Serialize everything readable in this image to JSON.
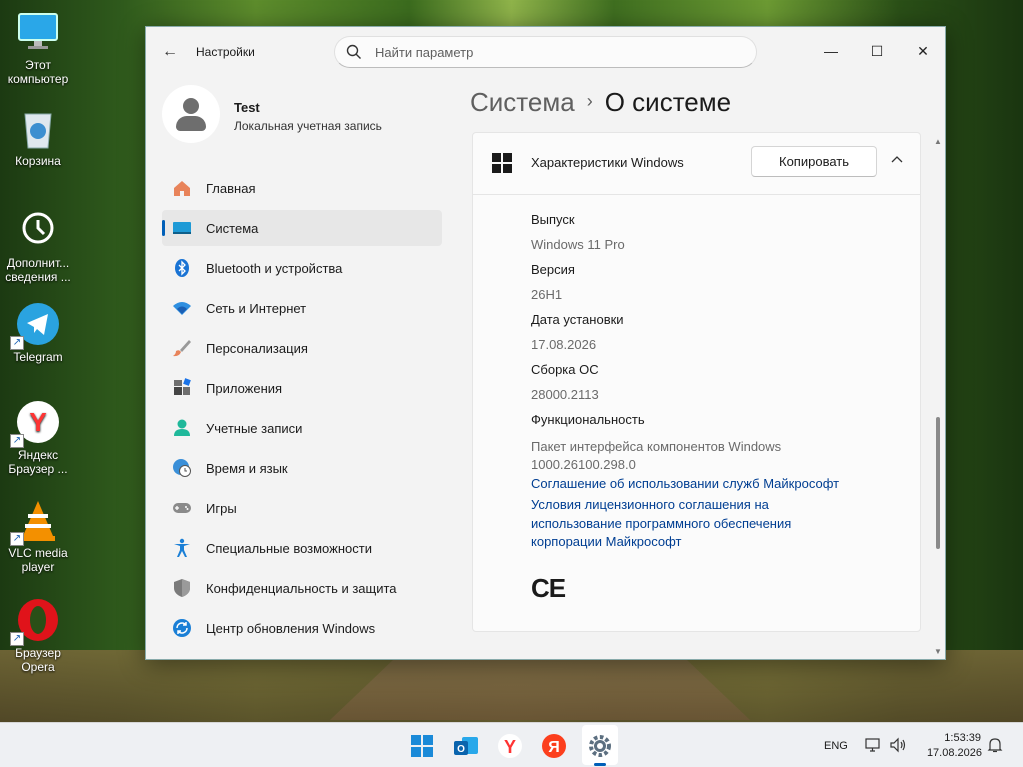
{
  "desktop": {
    "icons": [
      {
        "label": "Этот компьютер",
        "icon": "monitor-icon"
      },
      {
        "label": "Корзина",
        "icon": "recycle-bin-icon"
      },
      {
        "label": "Дополнит... сведения ...",
        "icon": "clock-icon"
      },
      {
        "label": "Telegram",
        "icon": "telegram-icon"
      },
      {
        "label": "Яндекс Браузер ...",
        "icon": "yandex-browser-icon"
      },
      {
        "label": "VLC media player",
        "icon": "vlc-icon"
      },
      {
        "label": "Браузер Opera",
        "icon": "opera-icon"
      }
    ]
  },
  "window": {
    "app_title": "Настройки",
    "search_placeholder": "Найти параметр",
    "controls": {
      "minimize": "—",
      "maximize": "☐",
      "close": "✕"
    }
  },
  "profile": {
    "name": "Test",
    "account_type": "Локальная учетная запись"
  },
  "nav": {
    "items": [
      {
        "label": "Главная",
        "icon": "home-icon"
      },
      {
        "label": "Система",
        "icon": "system-icon",
        "active": true
      },
      {
        "label": "Bluetooth и устройства",
        "icon": "bluetooth-icon"
      },
      {
        "label": "Сеть и Интернет",
        "icon": "wifi-icon"
      },
      {
        "label": "Персонализация",
        "icon": "brush-icon"
      },
      {
        "label": "Приложения",
        "icon": "apps-icon"
      },
      {
        "label": "Учетные записи",
        "icon": "accounts-icon"
      },
      {
        "label": "Время и язык",
        "icon": "globe-clock-icon"
      },
      {
        "label": "Игры",
        "icon": "gamepad-icon"
      },
      {
        "label": "Специальные возможности",
        "icon": "accessibility-icon"
      },
      {
        "label": "Конфиденциальность и защита",
        "icon": "shield-icon"
      },
      {
        "label": "Центр обновления Windows",
        "icon": "update-icon"
      }
    ]
  },
  "content": {
    "breadcrumb_parent": "Система",
    "breadcrumb_sep": "›",
    "breadcrumb_current": "О системе",
    "card_title": "Характеристики Windows",
    "copy_button": "Копировать",
    "specs": [
      {
        "label": "Выпуск",
        "value": "Windows 11 Pro"
      },
      {
        "label": "Версия",
        "value": "26H1"
      },
      {
        "label": "Дата установки",
        "value": "17.08.2026"
      },
      {
        "label": "Сборка ОС",
        "value": "28000.2113"
      },
      {
        "label": "Функциональность",
        "value": "Пакет интерфейса компонентов Windows 1000.26100.298.0"
      }
    ],
    "links": [
      "Соглашение об использовании служб Майкрософт",
      "Условия лицензионного соглашения на использование программного обеспечения корпорации Майкрософт"
    ],
    "ce_mark": "CE"
  },
  "taskbar": {
    "apps": [
      "start-icon",
      "outlook-icon",
      "yandex-browser-icon",
      "yandex-icon",
      "settings-icon"
    ],
    "lang": "ENG",
    "time": "1:53:39",
    "date": "17.08.2026"
  },
  "colors": {
    "accent": "#005fb8",
    "link": "#003e92"
  }
}
